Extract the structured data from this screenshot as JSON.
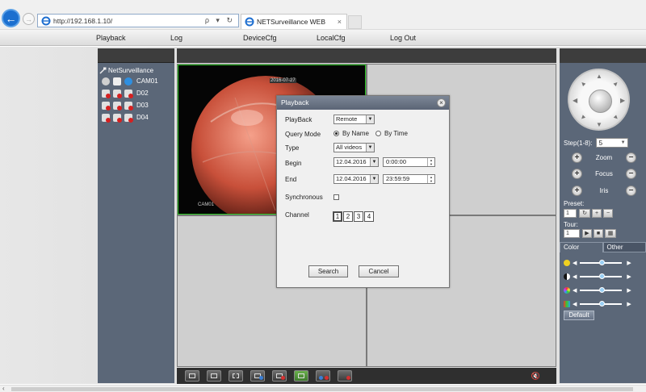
{
  "browser": {
    "url": "http://192.168.1.10/",
    "url_tools": "ρ ▾ ↻",
    "tab_title": "NETSurveillance WEB",
    "tab_close": "×"
  },
  "menu": {
    "items": [
      "Playback",
      "Log",
      "DeviceCfg",
      "LocalCfg",
      "Log Out"
    ]
  },
  "device_tree": {
    "root": "NetSurveillance",
    "channels": [
      "CAM01",
      "D02",
      "D03",
      "D04"
    ]
  },
  "video": {
    "osd_time": "2016-07-27",
    "osd_channel": "CAM01"
  },
  "ptz": {
    "step_label": "Step(1-8):",
    "step_value": "5",
    "zoom": "Zoom",
    "focus": "Focus",
    "iris": "Iris",
    "minus": "−",
    "plus": "+",
    "preset_label": "Preset:",
    "preset_value": "1",
    "tour_label": "Tour:",
    "tour_value": "1"
  },
  "image_settings": {
    "tabs": [
      "Color",
      "Other"
    ],
    "left_arrow": "◀",
    "right_arrow": "▶",
    "default_label": "Default"
  },
  "dialog": {
    "title": "Playback",
    "close": "×",
    "playback_label": "PlayBack",
    "playback_value": "Remote",
    "query_mode_label": "Query Mode",
    "by_name": "By Name",
    "by_time": "By Time",
    "type_label": "Type",
    "type_value": "All videos",
    "begin_label": "Begin",
    "begin_date": "12.04.2016",
    "begin_time": "0:00:00",
    "end_label": "End",
    "end_date": "12.04.2016",
    "end_time": "23:59:59",
    "synchronous_label": "Synchronous",
    "channel_label": "Channel",
    "channels": [
      "1",
      "2",
      "3",
      "4"
    ],
    "search": "Search",
    "cancel": "Cancel"
  },
  "colors": {
    "panel": "#5b6778",
    "panel_header": "#3d3d3d",
    "active_cell_border": "#27c21f",
    "dialog_title": "#5b6576"
  }
}
